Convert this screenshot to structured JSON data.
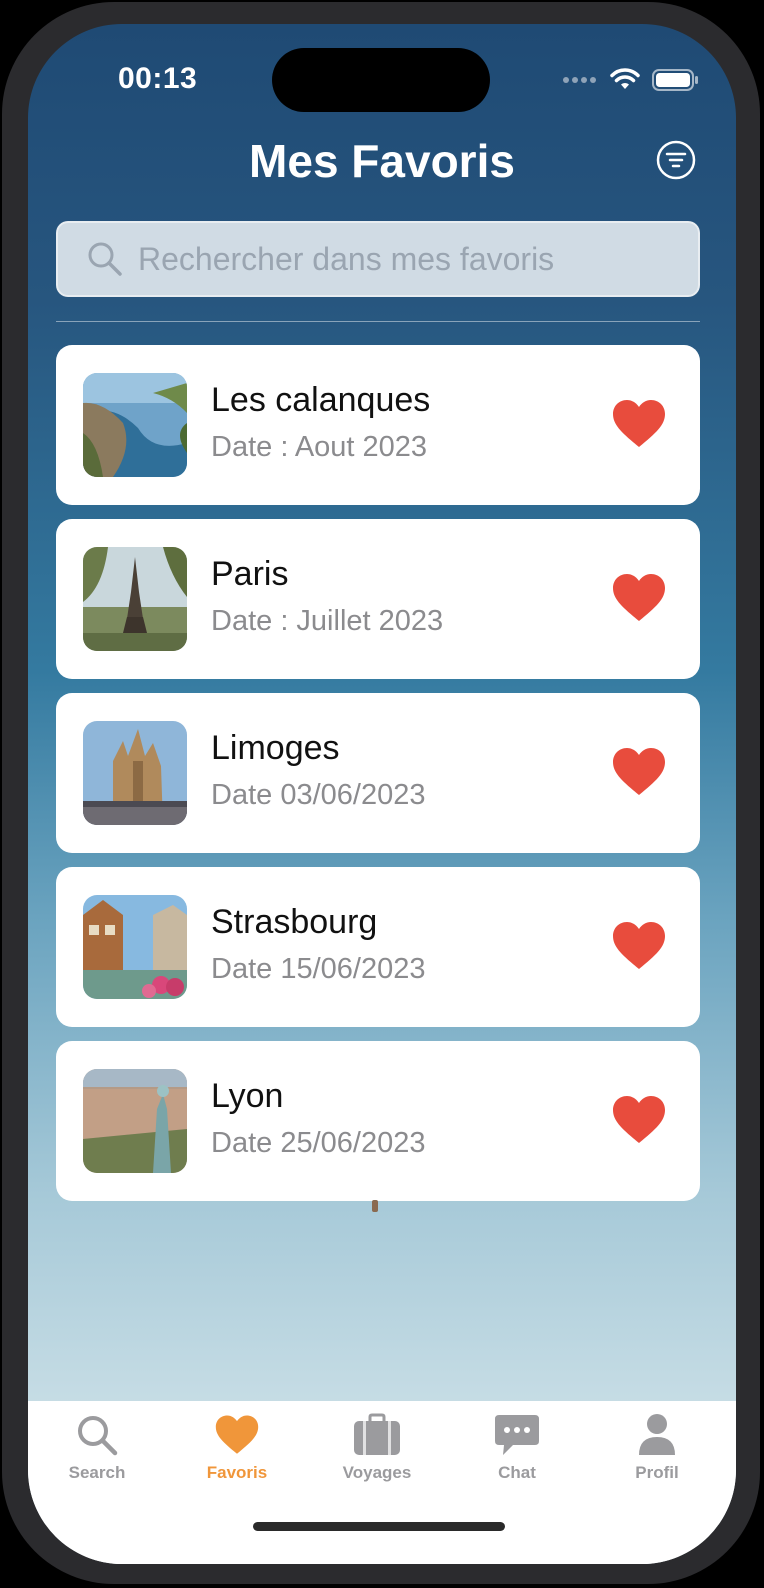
{
  "status_bar": {
    "time": "00:13",
    "icons": [
      "signal-dots-icon",
      "wifi-icon",
      "battery-icon"
    ]
  },
  "header": {
    "title": "Mes Favoris",
    "filter_icon": "filter-icon"
  },
  "search": {
    "placeholder": "Rechercher dans mes favoris",
    "icon": "search-icon"
  },
  "favorites": [
    {
      "title": "Les calanques",
      "date": "Date : Aout 2023",
      "liked": true
    },
    {
      "title": "Paris",
      "date": "Date : Juillet 2023",
      "liked": true
    },
    {
      "title": "Limoges",
      "date": "Date 03/06/2023",
      "liked": true
    },
    {
      "title": "Strasbourg",
      "date": "Date 15/06/2023",
      "liked": true
    },
    {
      "title": "Lyon",
      "date": "Date 25/06/2023",
      "liked": true
    }
  ],
  "tabbar": {
    "tabs": [
      {
        "label": "Search",
        "icon": "search-icon",
        "active": false
      },
      {
        "label": "Favoris",
        "icon": "heart-icon",
        "active": true
      },
      {
        "label": "Voyages",
        "icon": "suitcase-icon",
        "active": false
      },
      {
        "label": "Chat",
        "icon": "chat-bubble-icon",
        "active": false
      },
      {
        "label": "Profil",
        "icon": "person-icon",
        "active": false
      }
    ]
  },
  "colors": {
    "accent": "#f0963a",
    "heart": "#e84c3d",
    "tab_inactive": "#9b9b9e",
    "bg_top": "#1f4a74",
    "bg_bottom": "#d7e6ea"
  }
}
